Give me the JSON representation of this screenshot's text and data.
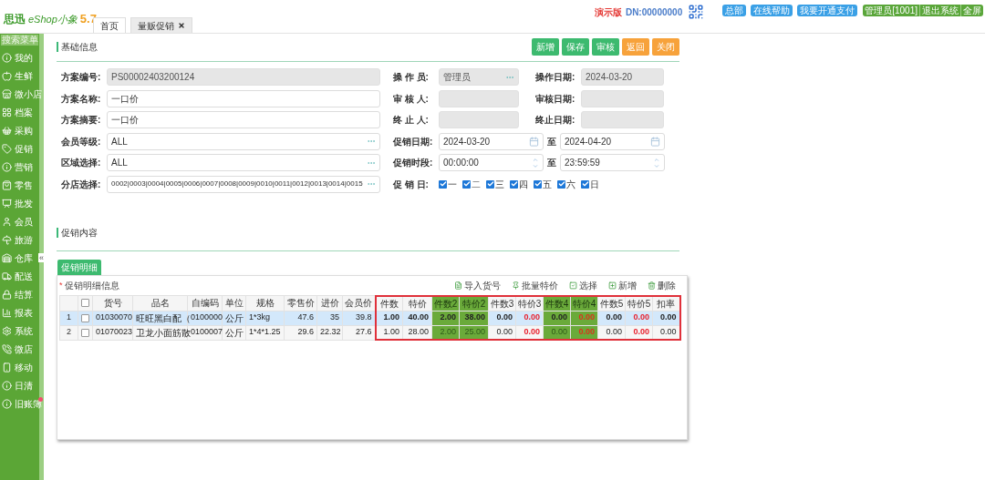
{
  "header": {
    "logo_brand": "思迅",
    "logo_product": "eShop小象",
    "logo_version": "5.7",
    "tabs": [
      {
        "label": "首页",
        "selected": false,
        "closable": false
      },
      {
        "label": "量贩促销",
        "selected": true,
        "closable": true
      }
    ],
    "edition": "演示版",
    "dn": "DN:00000000",
    "blue_links": [
      "总部",
      "在线帮助",
      "我要开通支付"
    ],
    "green_links": [
      "管理员[1001]",
      "退出系统",
      "全屏"
    ]
  },
  "sidebar": {
    "search_placeholder": "搜索菜单",
    "collapse": "«",
    "items": [
      {
        "label": "我的",
        "alert": false
      },
      {
        "label": "生鲜",
        "alert": false
      },
      {
        "label": "微小店",
        "alert": false
      },
      {
        "label": "档案",
        "alert": false
      },
      {
        "label": "采购",
        "alert": false
      },
      {
        "label": "促销",
        "alert": false
      },
      {
        "label": "营销",
        "alert": false
      },
      {
        "label": "零售",
        "alert": false
      },
      {
        "label": "批发",
        "alert": false
      },
      {
        "label": "会员",
        "alert": false
      },
      {
        "label": "旅游",
        "alert": false
      },
      {
        "label": "仓库",
        "alert": false
      },
      {
        "label": "配送",
        "alert": false
      },
      {
        "label": "结算",
        "alert": false
      },
      {
        "label": "报表",
        "alert": false
      },
      {
        "label": "系统",
        "alert": false
      },
      {
        "label": "微店",
        "alert": false
      },
      {
        "label": "移动",
        "alert": false
      },
      {
        "label": "日清",
        "alert": false
      },
      {
        "label": "旧账簿",
        "alert": true
      }
    ]
  },
  "basic_info": {
    "title": "基础信息",
    "buttons": [
      {
        "label": "新增",
        "kind": "primary"
      },
      {
        "label": "保存",
        "kind": "primary"
      },
      {
        "label": "审核",
        "kind": "primary"
      },
      {
        "label": "返回",
        "kind": "warning"
      },
      {
        "label": "关闭",
        "kind": "warning"
      }
    ],
    "fields": [
      {
        "label": "方案编号:",
        "value": "PS00002403200124",
        "disabled": true,
        "picker": false
      },
      {
        "label": "方案名称:",
        "value": "一口价",
        "disabled": false,
        "picker": false
      },
      {
        "label": "方案摘要:",
        "value": "一口价",
        "disabled": false,
        "picker": false
      },
      {
        "label": "会员等级:",
        "value": "ALL",
        "disabled": false,
        "picker": true
      },
      {
        "label": "区域选择:",
        "value": "ALL",
        "disabled": false,
        "picker": true
      },
      {
        "label": "分店选择:",
        "value": "0002|0003|0004|0005|0006|0007|0008|0009|0010|0011|0012|0013|0014|0015",
        "disabled": false,
        "picker": true
      }
    ],
    "people": [
      {
        "label": "操 作 员:",
        "value": "管理员",
        "disabled": true,
        "picker": true
      },
      {
        "label": "审 核 人:",
        "disabled": true,
        "picker": false
      },
      {
        "label": "终 止 人:",
        "disabled": true,
        "picker": false
      }
    ],
    "dates": [
      {
        "label": "操作日期:",
        "value": "2024-03-20",
        "disabled": true
      },
      {
        "label": "审核日期:",
        "disabled": true
      },
      {
        "label": "终止日期:",
        "disabled": true
      }
    ],
    "promo_date": {
      "label": "促销日期:",
      "from": "2024-03-20",
      "separator": "至",
      "to": "2024-04-20"
    },
    "promo_time": {
      "label": "促销时段:",
      "from": "00:00:00",
      "separator": "至",
      "to": "23:59:59"
    },
    "promo_days": {
      "label": "促 销 日:",
      "days": [
        {
          "label": "一",
          "checked": true
        },
        {
          "label": "二",
          "checked": true
        },
        {
          "label": "三",
          "checked": true
        },
        {
          "label": "四",
          "checked": true
        },
        {
          "label": "五",
          "checked": true
        },
        {
          "label": "六",
          "checked": true
        },
        {
          "label": "日",
          "checked": true
        }
      ]
    }
  },
  "content": {
    "title": "促销内容",
    "tabs": [
      {
        "label": "促销明细",
        "selected": true
      }
    ],
    "panel_title": "促销明细信息",
    "required_mark": "*",
    "toolbar": [
      "导入货号",
      "批量特价",
      "选择",
      "新增",
      "删除"
    ],
    "table": {
      "all_checked": false,
      "columns": [
        {
          "label": "货号",
          "highlighted": false,
          "red_values": false,
          "in_box": false
        },
        {
          "label": "品名",
          "highlighted": false,
          "red_values": false,
          "in_box": false
        },
        {
          "label": "自编码",
          "highlighted": false,
          "red_values": false,
          "in_box": false
        },
        {
          "label": "单位",
          "highlighted": false,
          "red_values": false,
          "in_box": false
        },
        {
          "label": "规格",
          "highlighted": false,
          "red_values": false,
          "in_box": false
        },
        {
          "label": "零售价",
          "highlighted": false,
          "red_values": false,
          "in_box": false
        },
        {
          "label": "进价",
          "highlighted": false,
          "red_values": false,
          "in_box": false
        },
        {
          "label": "会员价",
          "highlighted": false,
          "red_values": false,
          "in_box": false
        },
        {
          "label": "件数",
          "highlighted": false,
          "red_values": false,
          "in_box": true
        },
        {
          "label": "特价",
          "highlighted": false,
          "red_values": false,
          "in_box": true
        },
        {
          "label": "件数2",
          "highlighted": true,
          "red_values": false,
          "in_box": true
        },
        {
          "label": "特价2",
          "highlighted": true,
          "red_values": false,
          "in_box": true
        },
        {
          "label": "件数3",
          "highlighted": false,
          "red_values": false,
          "in_box": true
        },
        {
          "label": "特价3",
          "highlighted": false,
          "red_values": true,
          "in_box": true
        },
        {
          "label": "件数4",
          "highlighted": true,
          "red_values": false,
          "in_box": true
        },
        {
          "label": "特价4",
          "highlighted": true,
          "red_values": true,
          "in_box": true
        },
        {
          "label": "件数5",
          "highlighted": false,
          "red_values": false,
          "in_box": true
        },
        {
          "label": "特价5",
          "highlighted": false,
          "red_values": true,
          "in_box": true
        },
        {
          "label": "扣率",
          "highlighted": false,
          "red_values": false,
          "in_box": true
        }
      ],
      "rows": [
        {
          "number": "1",
          "checked": false,
          "selected": true,
          "cells": [
            "01030070",
            "旺旺黑白配（",
            "0100000",
            "公斤",
            "1*3kg",
            "47.6",
            "35",
            "39.8",
            "1.00",
            "40.00",
            "2.00",
            "38.00",
            "0.00",
            "0.00",
            "0.00",
            "0.00",
            "0.00",
            "0.00",
            "0.00"
          ]
        },
        {
          "number": "2",
          "checked": false,
          "selected": false,
          "cells": [
            "01070023",
            "卫龙小面筋散",
            "0100007",
            "公斤",
            "1*4*1.25",
            "29.6",
            "22.32",
            "27.6",
            "1.00",
            "28.00",
            "2.00",
            "25.00",
            "0.00",
            "0.00",
            "0.00",
            "0.00",
            "0.00",
            "0.00",
            "0.00"
          ]
        }
      ]
    }
  }
}
